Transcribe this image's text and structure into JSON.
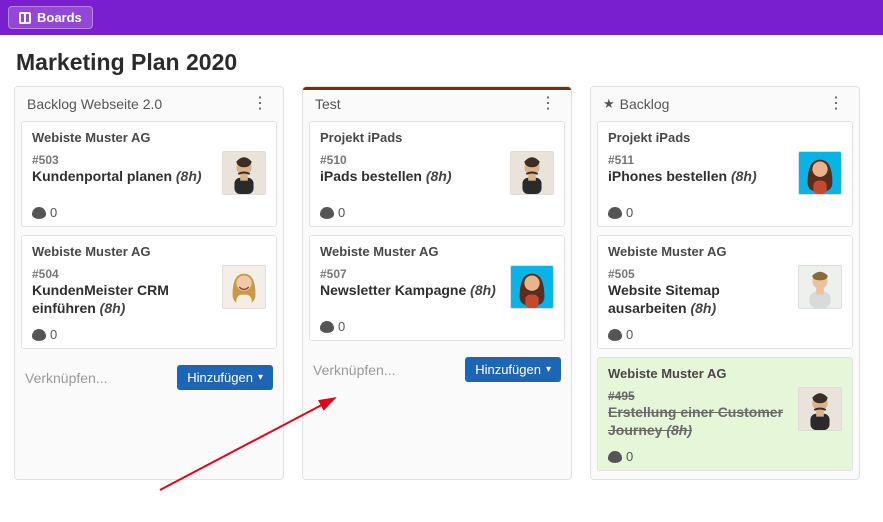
{
  "header": {
    "boards_label": "Boards"
  },
  "page": {
    "title": "Marketing Plan 2020"
  },
  "common": {
    "link_placeholder": "Verknüpfen...",
    "add_label": "Hinzufügen",
    "comments_zero": "0"
  },
  "columns": [
    {
      "title": "Backlog Webseite 2.0",
      "starred": false,
      "accent": false,
      "has_footer": true,
      "cards": [
        {
          "project": "Webiste Muster AG",
          "id": "#503",
          "title": "Kundenportal planen",
          "hours": "(8h)",
          "avatar": "m1",
          "comments": "0",
          "done": false
        },
        {
          "project": "Webiste Muster AG",
          "id": "#504",
          "title": "KundenMeister CRM einführen",
          "hours": "(8h)",
          "avatar": "f1",
          "comments": "0",
          "done": false
        }
      ]
    },
    {
      "title": "Test",
      "starred": false,
      "accent": true,
      "has_footer": true,
      "cards": [
        {
          "project": "Projekt iPads",
          "id": "#510",
          "title": "iPads bestellen",
          "hours": "(8h)",
          "avatar": "m1",
          "comments": "0",
          "done": false
        },
        {
          "project": "Webiste Muster AG",
          "id": "#507",
          "title": "Newsletter Kampagne",
          "hours": "(8h)",
          "avatar": "f2",
          "comments": "0",
          "done": false
        }
      ]
    },
    {
      "title": "Backlog",
      "starred": true,
      "accent": false,
      "has_footer": false,
      "cards": [
        {
          "project": "Projekt iPads",
          "id": "#511",
          "title": "iPhones bestellen",
          "hours": "(8h)",
          "avatar": "f2",
          "comments": "0",
          "done": false
        },
        {
          "project": "Webiste Muster AG",
          "id": "#505",
          "title": "Website Sitemap ausarbeiten",
          "hours": "(8h)",
          "avatar": "m2",
          "comments": "0",
          "done": false
        },
        {
          "project": "Webiste Muster AG",
          "id": "#495",
          "title": "Erstellung einer Customer Journey",
          "hours": "(8h)",
          "avatar": "m1",
          "comments": "0",
          "done": true
        }
      ]
    }
  ]
}
